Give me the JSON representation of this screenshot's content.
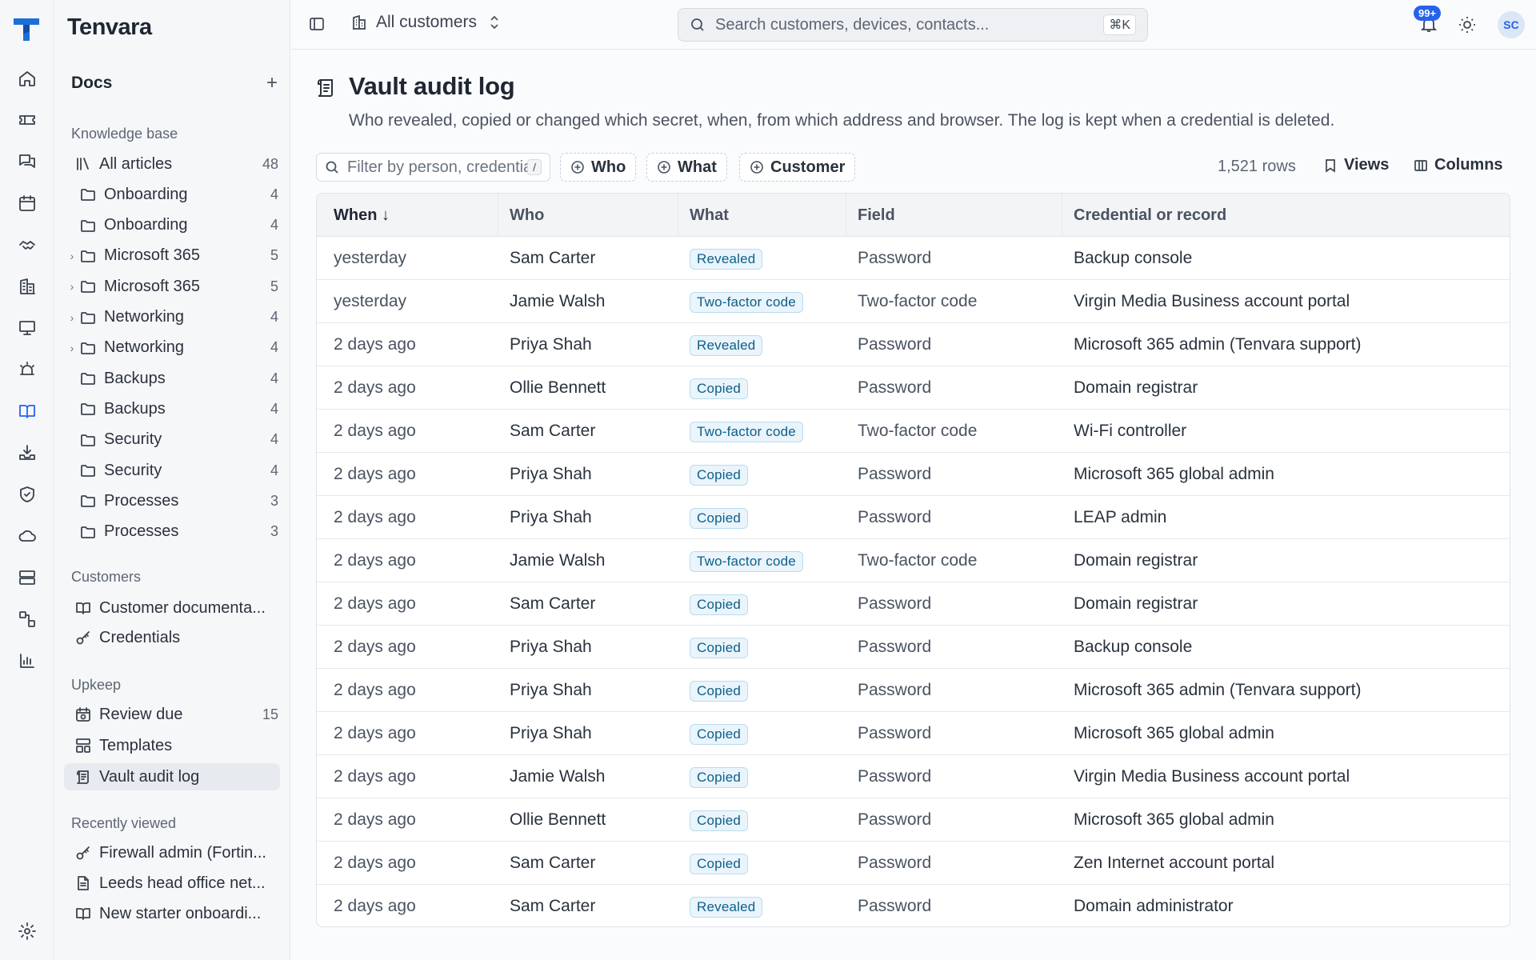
{
  "app": {
    "brand": "Tenvara"
  },
  "sidebar": {
    "header": "Docs",
    "add_label": "+",
    "sections": {
      "knowledge_base": "Knowledge base",
      "customers": "Customers",
      "upkeep": "Upkeep",
      "recently_viewed": "Recently viewed"
    },
    "kb_items": [
      {
        "label": "All articles",
        "count": "48",
        "icon": "library-icon"
      },
      {
        "label": "Onboarding",
        "count": "4",
        "icon": "folder-icon"
      },
      {
        "label": "Onboarding",
        "count": "4",
        "icon": "folder-icon"
      },
      {
        "label": "Microsoft 365",
        "count": "5",
        "icon": "folder-icon",
        "expandable": true
      },
      {
        "label": "Microsoft 365",
        "count": "5",
        "icon": "folder-icon",
        "expandable": true
      },
      {
        "label": "Networking",
        "count": "4",
        "icon": "folder-icon",
        "expandable": true
      },
      {
        "label": "Networking",
        "count": "4",
        "icon": "folder-icon",
        "expandable": true
      },
      {
        "label": "Backups",
        "count": "4",
        "icon": "folder-icon"
      },
      {
        "label": "Backups",
        "count": "4",
        "icon": "folder-icon"
      },
      {
        "label": "Security",
        "count": "4",
        "icon": "folder-icon"
      },
      {
        "label": "Security",
        "count": "4",
        "icon": "folder-icon"
      },
      {
        "label": "Processes",
        "count": "3",
        "icon": "folder-icon"
      },
      {
        "label": "Processes",
        "count": "3",
        "icon": "folder-icon"
      }
    ],
    "customer_items": [
      {
        "label": "Customer documenta...",
        "icon": "book-icon"
      },
      {
        "label": "Credentials",
        "icon": "key-icon"
      }
    ],
    "upkeep_items": [
      {
        "label": "Review due",
        "count": "15",
        "icon": "calendar-clock-icon"
      },
      {
        "label": "Templates",
        "icon": "template-icon"
      },
      {
        "label": "Vault audit log",
        "icon": "scroll-icon",
        "active": true
      }
    ],
    "recent_items": [
      {
        "label": "Firewall admin (Fortin...",
        "icon": "key-icon"
      },
      {
        "label": "Leeds head office net...",
        "icon": "document-icon"
      },
      {
        "label": "New starter onboardi...",
        "icon": "book-icon"
      }
    ]
  },
  "topbar": {
    "customer_scope": "All customers",
    "search_placeholder": "Search customers, devices, contacts...",
    "search_shortcut": "⌘K",
    "notification_badge": "99+",
    "avatar_initials": "SC"
  },
  "page": {
    "title": "Vault audit log",
    "subtitle": "Who revealed, copied or changed which secret, when, from which address and browser. The log is kept when a credential is deleted.",
    "filter_placeholder": "Filter by person, credential",
    "filter_shortcut": "/",
    "chips": [
      "Who",
      "What",
      "Customer"
    ],
    "row_count": "1,521 rows",
    "views_label": "Views",
    "columns_label": "Columns"
  },
  "table": {
    "columns": [
      "When",
      "Who",
      "What",
      "Field",
      "Credential or record"
    ],
    "sort_indicator": "↓",
    "rows": [
      {
        "when": "yesterday",
        "who": "Sam Carter",
        "what": "Revealed",
        "field": "Password",
        "record": "Backup console"
      },
      {
        "when": "yesterday",
        "who": "Jamie Walsh",
        "what": "Two-factor code",
        "field": "Two-factor code",
        "record": "Virgin Media Business account portal"
      },
      {
        "when": "2 days ago",
        "who": "Priya Shah",
        "what": "Revealed",
        "field": "Password",
        "record": "Microsoft 365 admin (Tenvara support)"
      },
      {
        "when": "2 days ago",
        "who": "Ollie Bennett",
        "what": "Copied",
        "field": "Password",
        "record": "Domain registrar"
      },
      {
        "when": "2 days ago",
        "who": "Sam Carter",
        "what": "Two-factor code",
        "field": "Two-factor code",
        "record": "Wi-Fi controller"
      },
      {
        "when": "2 days ago",
        "who": "Priya Shah",
        "what": "Copied",
        "field": "Password",
        "record": "Microsoft 365 global admin"
      },
      {
        "when": "2 days ago",
        "who": "Priya Shah",
        "what": "Copied",
        "field": "Password",
        "record": "LEAP admin"
      },
      {
        "when": "2 days ago",
        "who": "Jamie Walsh",
        "what": "Two-factor code",
        "field": "Two-factor code",
        "record": "Domain registrar"
      },
      {
        "when": "2 days ago",
        "who": "Sam Carter",
        "what": "Copied",
        "field": "Password",
        "record": "Domain registrar"
      },
      {
        "when": "2 days ago",
        "who": "Priya Shah",
        "what": "Copied",
        "field": "Password",
        "record": "Backup console"
      },
      {
        "when": "2 days ago",
        "who": "Priya Shah",
        "what": "Copied",
        "field": "Password",
        "record": "Microsoft 365 admin (Tenvara support)"
      },
      {
        "when": "2 days ago",
        "who": "Priya Shah",
        "what": "Copied",
        "field": "Password",
        "record": "Microsoft 365 global admin"
      },
      {
        "when": "2 days ago",
        "who": "Jamie Walsh",
        "what": "Copied",
        "field": "Password",
        "record": "Virgin Media Business account portal"
      },
      {
        "when": "2 days ago",
        "who": "Ollie Bennett",
        "what": "Copied",
        "field": "Password",
        "record": "Microsoft 365 global admin"
      },
      {
        "when": "2 days ago",
        "who": "Sam Carter",
        "what": "Copied",
        "field": "Password",
        "record": "Zen Internet account portal"
      },
      {
        "when": "2 days ago",
        "who": "Sam Carter",
        "what": "Revealed",
        "field": "Password",
        "record": "Domain administrator"
      }
    ]
  },
  "colors": {
    "accent": "#2563eb",
    "brand_logo": "#1d6fd8",
    "badge_bg": "#eaf4fb",
    "badge_text": "#0b5f8a"
  },
  "rail_icons": [
    "home-icon",
    "ticket-icon",
    "chat-icon",
    "calendar-icon",
    "handshake-icon",
    "building-icon",
    "monitor-icon",
    "alarm-icon",
    "book-open-icon",
    "download-tray-icon",
    "shield-icon",
    "cloud-icon",
    "server-icon",
    "workflow-icon",
    "chart-icon",
    "settings-icon"
  ]
}
